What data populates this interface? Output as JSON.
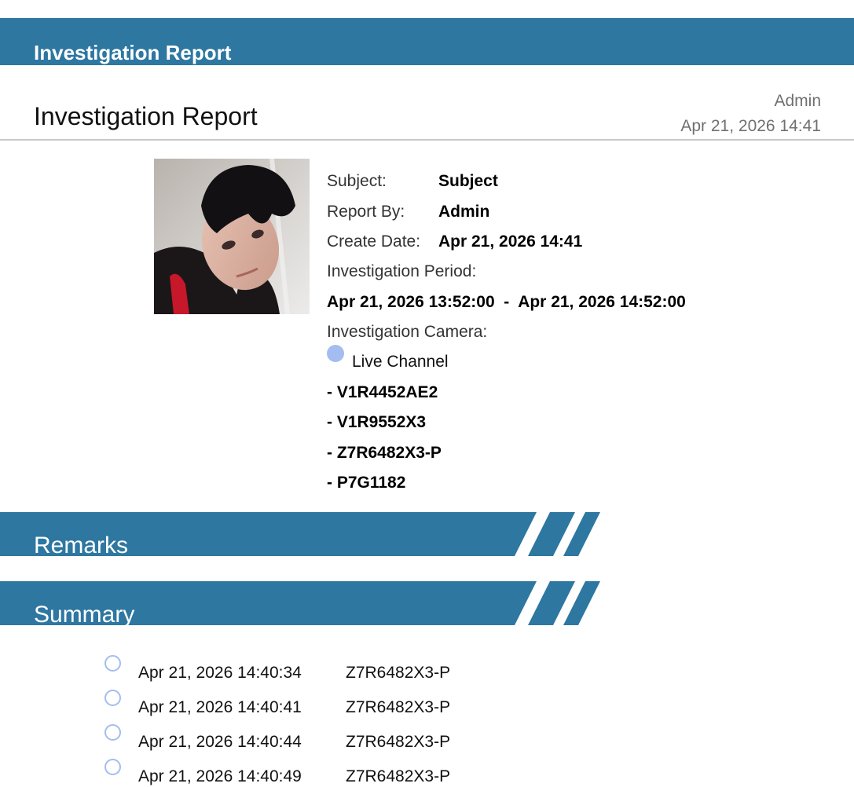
{
  "banner": {
    "title": "Investigation Report"
  },
  "header": {
    "title": "Investigation Report",
    "user": "Admin",
    "date": "Apr 21, 2026 14:41"
  },
  "details": {
    "subject_label": "Subject:",
    "subject_value": "Subject",
    "report_by_label": "Report By:",
    "report_by_value": "Admin",
    "create_date_label": "Create Date:",
    "create_date_value": "Apr 21, 2026 14:41",
    "period_label": "Investigation Period:",
    "period_value": "Apr 21, 2026 13:52:00  -  Apr 21, 2026 14:52:00",
    "camera_label": "Investigation Camera:",
    "channel_group": "Live Channel",
    "cameras": [
      "- V1R4452AE2",
      "- V1R9552X3",
      "- Z7R6482X3-P",
      "- P7G1182"
    ]
  },
  "sections": {
    "remarks": "Remarks",
    "summary": "Summary"
  },
  "events": [
    {
      "time": "Apr 21, 2026 14:40:34",
      "camera": "Z7R6482X3-P"
    },
    {
      "time": "Apr 21, 2026 14:40:41",
      "camera": "Z7R6482X3-P"
    },
    {
      "time": "Apr 21, 2026 14:40:44",
      "camera": "Z7R6482X3-P"
    },
    {
      "time": "Apr 21, 2026 14:40:49",
      "camera": "Z7R6482X3-P"
    }
  ],
  "colors": {
    "brand": "#2d77a1",
    "accent_dot": "#a3bdf0",
    "muted_text": "#707070"
  }
}
